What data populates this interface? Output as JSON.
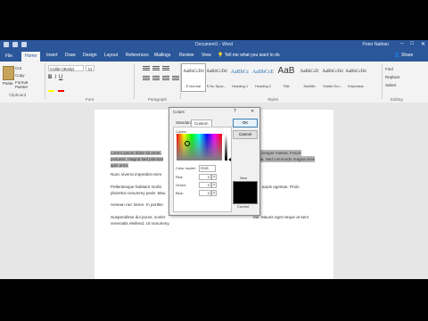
{
  "window": {
    "title": "Document1 - Word",
    "user": "Peter Nathan",
    "min": "–",
    "max": "□",
    "close": "✕"
  },
  "tabs": [
    "File",
    "Home",
    "Insert",
    "Draw",
    "Design",
    "Layout",
    "References",
    "Mailings",
    "Review",
    "View"
  ],
  "tell_me": "Tell me what you want to do",
  "share": "Share",
  "clipboard": {
    "paste": "Paste",
    "cut": "Cut",
    "copy": "Copy",
    "format_painter": "Format Painter",
    "group": "Clipboard"
  },
  "font": {
    "name": "Calibri (Body)",
    "size": "11",
    "bold": "B",
    "italic": "I",
    "underline": "U",
    "group": "Font"
  },
  "paragraph_group": "Paragraph",
  "styles": [
    {
      "preview": "AaBbCcDd",
      "name": "¶ Normal"
    },
    {
      "preview": "AaBbCcDd",
      "name": "¶ No Spac..."
    },
    {
      "preview": "AaBbCc",
      "name": "Heading 1"
    },
    {
      "preview": "AaBbCcE",
      "name": "Heading 2"
    },
    {
      "preview": "AaB",
      "name": "Title"
    },
    {
      "preview": "AaBbCcD",
      "name": "Subtitle"
    },
    {
      "preview": "AaBbCcDd",
      "name": "Subtle Em..."
    },
    {
      "preview": "AaBbCcDd",
      "name": "Emphasis"
    }
  ],
  "styles_group": "Styles",
  "editing": {
    "find": "Find",
    "replace": "Replace",
    "select": "Select",
    "group": "Editing"
  },
  "document": {
    "p1_highlight": "Lorem ipsum dolor sit amet,",
    "p1_right": "tur congue massa. Fusce",
    "p1_line2": "posuere, magna sed pulvinar",
    "p1_line2_right": "urna. Sed commodo magna eros",
    "p1_line3": "quis urna.",
    "p2": "Nunc viverra imperdiet enim",
    "p3_line1": "Pellentesque habitant morbi",
    "p3_line1_right": "s ac turpis egestas. Proin",
    "p3_line2": "pharetra nonummy pede. Mau",
    "p4": "Aenean nec lorem. In porttito",
    "p5_line1": "Suspendisse dui purus, sceler",
    "p5_line1_right": "tae, Mauris eget neque at sem",
    "p5_line2": "venenatis eleifend. Ut nonummy."
  },
  "dialog": {
    "title": "Colors",
    "help": "?",
    "close": "✕",
    "tab_standard": "Standard",
    "tab_custom": "Custom",
    "colors_label": "Colors:",
    "model_label": "Color model:",
    "model_value": "RGB",
    "red_label": "Red:",
    "red": "0",
    "green_label": "Green:",
    "green": "0",
    "blue_label": "Blue:",
    "blue": "0",
    "ok": "OK",
    "cancel": "Cancel",
    "new_label": "New",
    "current_label": "Current",
    "new_color": "#000000"
  },
  "colors": {
    "accent": "#2b579a",
    "highlight": "#b7b7b7"
  }
}
